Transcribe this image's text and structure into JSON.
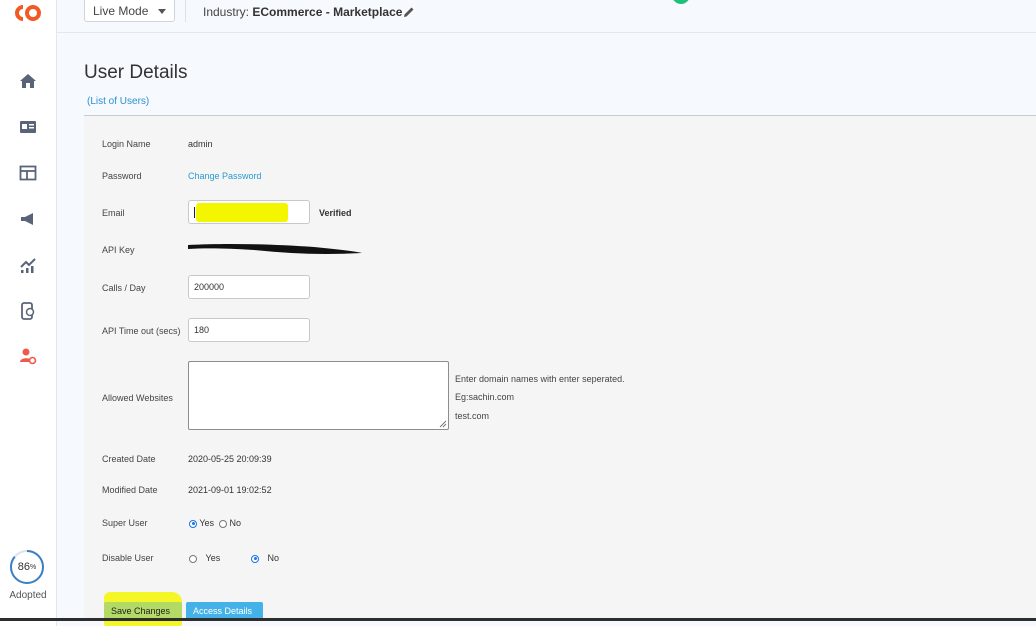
{
  "topbar": {
    "mode": "Live Mode",
    "industry_label": "Industry:",
    "industry_value": "ECommerce - Marketplace"
  },
  "sidebar": {
    "items": [
      {
        "icon": "home-icon"
      },
      {
        "icon": "id-card-icon"
      },
      {
        "icon": "layout-icon"
      },
      {
        "icon": "megaphone-icon"
      },
      {
        "icon": "analytics-icon"
      },
      {
        "icon": "mobile-web-icon"
      },
      {
        "icon": "user-settings-icon"
      }
    ],
    "adoption_value": "86",
    "adoption_unit": "%",
    "adoption_fraction": 0.86,
    "adoption_label": "Adopted"
  },
  "page": {
    "title": "User Details",
    "list_link": "(List of Users)"
  },
  "form": {
    "login_name_label": "Login Name",
    "login_name_value": "admin",
    "password_label": "Password",
    "password_link": "Change Password",
    "email_label": "Email",
    "email_status": "Verified",
    "api_key_label": "API Key",
    "calls_label": "Calls / Day",
    "calls_value": "200000",
    "timeout_label": "API Time out (secs)",
    "timeout_value": "180",
    "allowed_label": "Allowed Websites",
    "allowed_hint1": "Enter domain names with enter seperated.",
    "allowed_hint2": "Eg:sachin.com",
    "allowed_hint3": "test.com",
    "created_label": "Created Date",
    "created_value": "2020-05-25 20:09:39",
    "modified_label": "Modified Date",
    "modified_value": "2021-09-01 19:02:52",
    "super_label": "Super User",
    "super_yes": "Yes",
    "super_no": "No",
    "disable_label": "Disable User",
    "disable_yes": "Yes",
    "disable_no": "No"
  },
  "buttons": {
    "save": "Save Changes",
    "access": "Access Details"
  },
  "colors": {
    "brand": "#f15a24",
    "link": "#2b9ad1",
    "button": "#36a7dc",
    "status_online": "#21c07a"
  }
}
